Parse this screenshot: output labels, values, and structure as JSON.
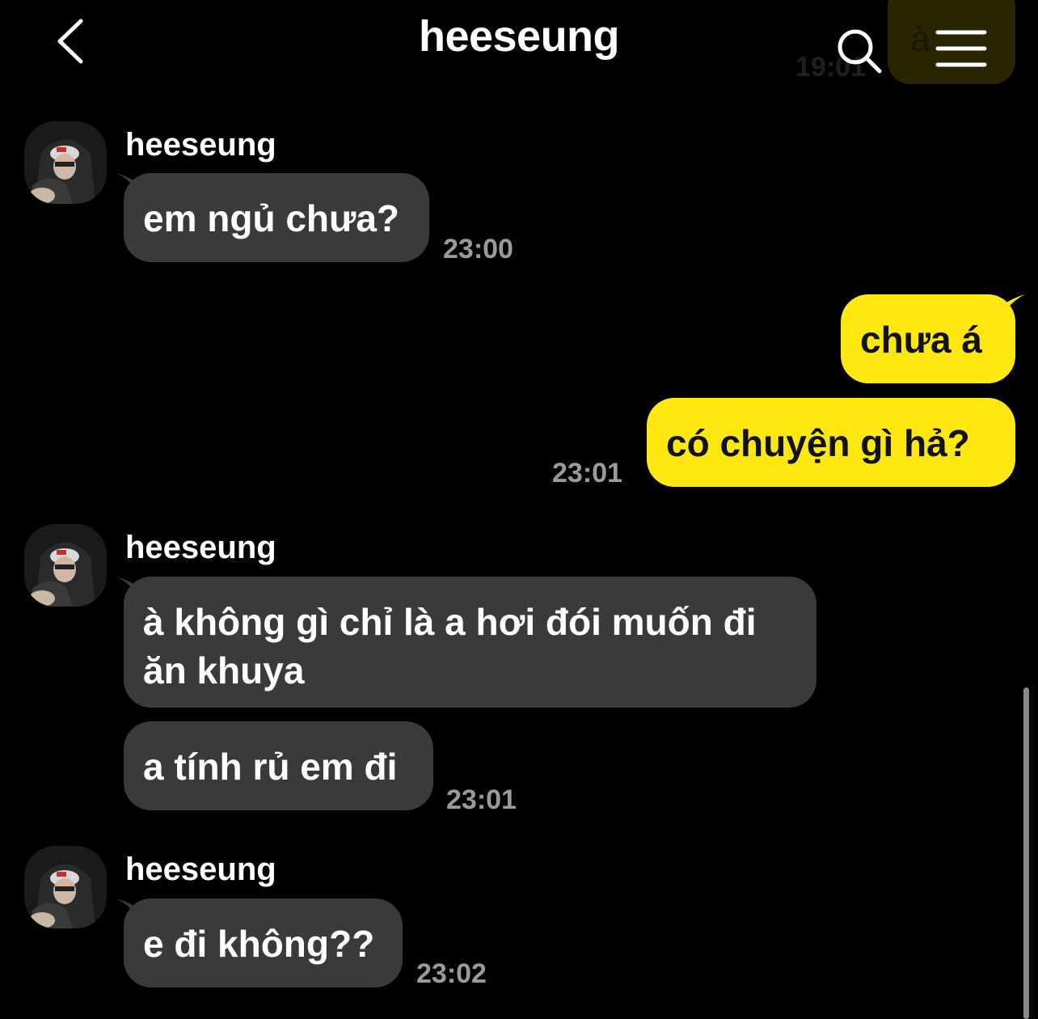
{
  "header": {
    "title": "heeseung",
    "back_icon": "chevron-left-icon",
    "search_icon": "search-icon",
    "menu_icon": "hamburger-menu-icon"
  },
  "peek": {
    "time": "19:01",
    "text": "à"
  },
  "colors": {
    "background": "#000000",
    "incoming_bubble": "#3a3a3c",
    "outgoing_bubble": "#ffe812",
    "timestamp": "#9a9a9a"
  },
  "messages": [
    {
      "sender": "heeseung",
      "text": "em ngủ chưa?",
      "time": "23:00"
    },
    {
      "text": "chưa á"
    },
    {
      "text": "có chuyện gì hả?",
      "time": "23:01"
    },
    {
      "sender": "heeseung",
      "text": "à không gì chỉ là a hơi đói muốn đi ăn khuya"
    },
    {
      "text": "a tính rủ em đi",
      "time": "23:01"
    },
    {
      "sender": "heeseung",
      "text": "e đi không??",
      "time": "23:02"
    }
  ]
}
